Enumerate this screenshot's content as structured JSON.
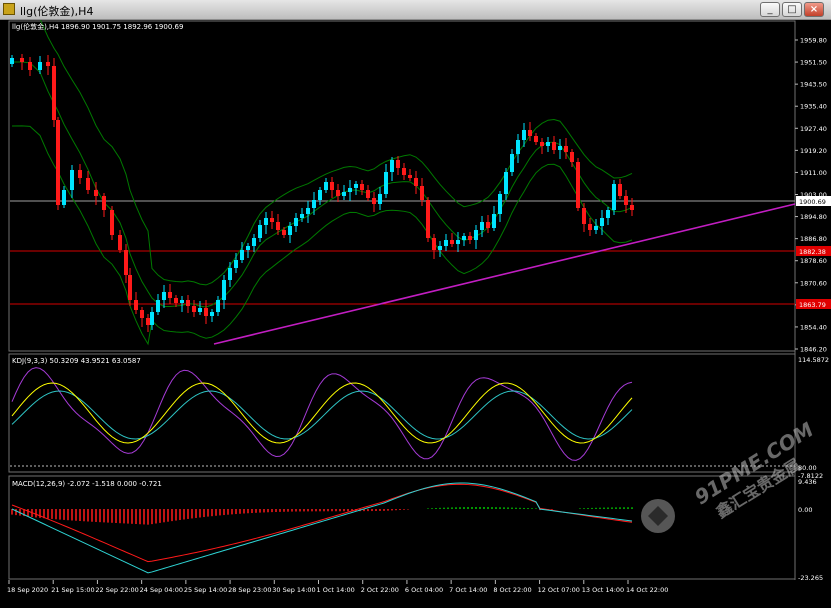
{
  "window": {
    "title": "llg(伦敦金),H4",
    "buttons": {
      "minimize": "_",
      "restore": "□",
      "close": "×"
    }
  },
  "main_panel": {
    "header": "llg(伦敦金),H4  1896.90 1901.75 1892.96 1900.69",
    "price_labels": [
      "1959.80",
      "1951.50",
      "1943.50",
      "1935.40",
      "1927.40",
      "1919.20",
      "1911.00",
      "1903.00",
      "1894.80",
      "1886.80",
      "1878.60",
      "1870.60",
      "1862.60",
      "1854.40",
      "1846.20"
    ],
    "current_price_tag": "1900.69",
    "level_tag_upper": "1882.38",
    "level_tag_lower": "1863.79"
  },
  "kdj_panel": {
    "header": "KDJ(9,3,3) 50.3209 43.9521 63.0587",
    "labels": [
      "114.5872",
      "80.00",
      "-7.8122"
    ]
  },
  "macd_panel": {
    "header": "MACD(12,26,9) -2.072 -1.518 0.000 -0.721",
    "labels": [
      "9.436",
      "0.00",
      "-23.265"
    ]
  },
  "time_axis": [
    "18 Sep 2020",
    "21 Sep 15:00",
    "22 Sep 22:00",
    "24 Sep 04:00",
    "25 Sep 14:00",
    "28 Sep 23:00",
    "30 Sep 14:00",
    "1 Oct 14:00",
    "2 Oct 22:00",
    "6 Oct 04:00",
    "7 Oct 14:00",
    "8 Oct 22:00",
    "12 Oct 07:00",
    "13 Oct 14:00",
    "14 Oct 22:00"
  ],
  "watermark": {
    "brand": "91PME.COM",
    "slogan": "鑫汇宝贵金属"
  },
  "colors": {
    "bull": "#00e5ff",
    "bear": "#ff1a1a",
    "bollinger": "#007a00",
    "trendline": "#c21ec2",
    "kdj_k": "#ffff00",
    "kdj_d": "#2ec4c4",
    "kdj_j": "#a53bd6",
    "macd_line": "#2ed4d4",
    "macd_signal": "#ff1a1a",
    "hist_pos": "#00cc00",
    "hist_neg": "#ff1a1a"
  }
}
